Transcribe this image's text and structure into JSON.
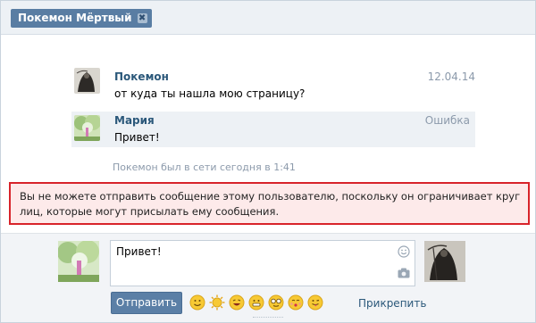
{
  "tab": {
    "title": "Покемон Мёртвый",
    "close_icon": "close-icon"
  },
  "messages": [
    {
      "author": "Покемон",
      "text": "от куда ты нашла мою страницу?",
      "meta": "12.04.14"
    },
    {
      "author": "Мария",
      "text": "Привет!",
      "meta": "Ошибка"
    }
  ],
  "status": {
    "last_seen": "Покемон был в сети сегодня в 1:41"
  },
  "alert": {
    "text": "Вы не можете отправить сообщение этому пользователю, поскольку он ограничивает круг лиц, которые могут присылать ему сообщения."
  },
  "composer": {
    "draft": "Привет!",
    "send_label": "Отправить",
    "attach_label": "Прикрепить",
    "emoji_icons": [
      "smile-emoji",
      "sun-emoji",
      "laugh-emoji",
      "grin-emoji",
      "glasses-emoji",
      "kiss-emoji",
      "tongue-emoji"
    ]
  },
  "colors": {
    "accent": "#597da3",
    "link": "#2b587a",
    "alert_border": "#d8232a",
    "alert_bg": "#fdeaea"
  }
}
